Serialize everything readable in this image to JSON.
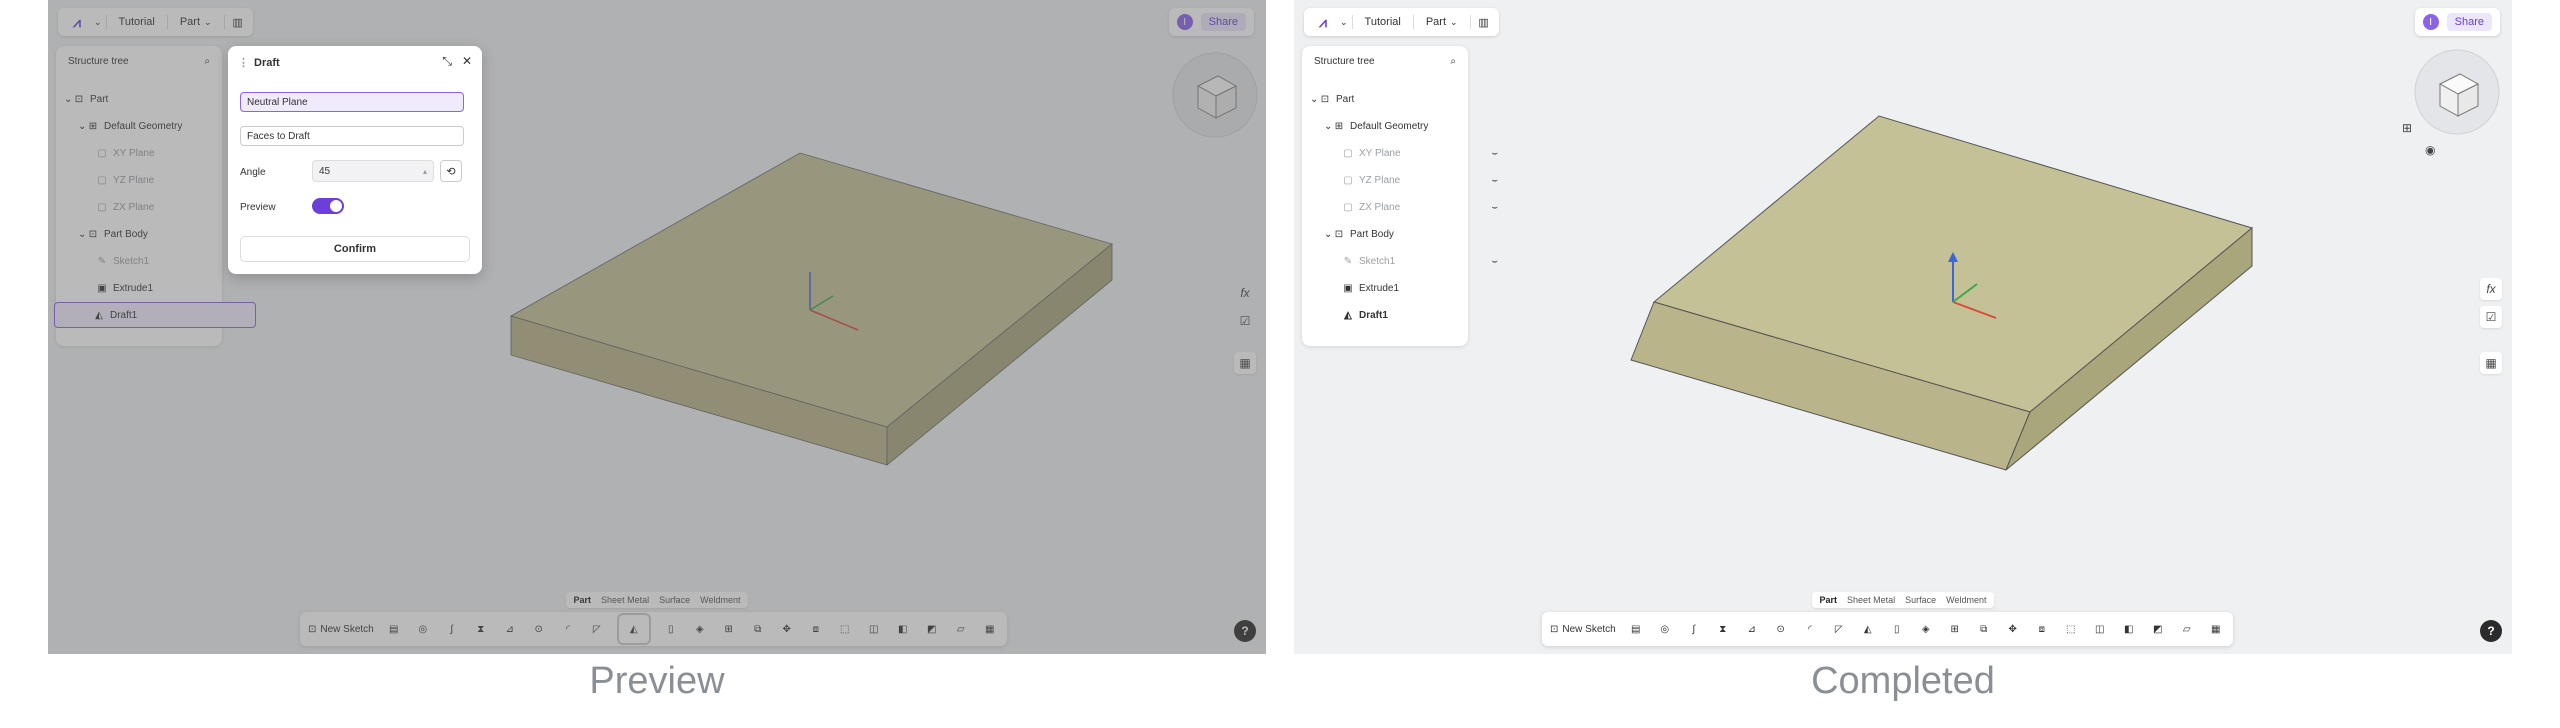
{
  "panels": [
    {
      "caption": "Preview",
      "topbar": {
        "project": "Tutorial",
        "mode": "Part"
      },
      "share_label": "Share",
      "avatar_letter": "I",
      "tree": {
        "title": "Structure tree",
        "items": [
          {
            "label": "Part"
          },
          {
            "label": "Default Geometry"
          },
          {
            "label": "XY Plane"
          },
          {
            "label": "YZ Plane"
          },
          {
            "label": "ZX Plane"
          },
          {
            "label": "Part Body"
          },
          {
            "label": "Sketch1"
          },
          {
            "label": "Extrude1"
          },
          {
            "label": "Draft1"
          }
        ]
      },
      "dialog": {
        "title": "Draft",
        "neutral_plane": "Neutral Plane",
        "faces_to_draft": "Faces to Draft",
        "angle_label": "Angle",
        "angle_value": "45",
        "preview_label": "Preview",
        "preview_on": true,
        "confirm_label": "Confirm"
      },
      "bottom_tabs": [
        "Part",
        "Sheet Metal",
        "Surface",
        "Weldment"
      ],
      "new_sketch_label": "New Sketch",
      "help_label": "?"
    },
    {
      "caption": "Completed",
      "topbar": {
        "project": "Tutorial",
        "mode": "Part"
      },
      "share_label": "Share",
      "avatar_letter": "I",
      "tree": {
        "title": "Structure tree",
        "items": [
          {
            "label": "Part"
          },
          {
            "label": "Default Geometry"
          },
          {
            "label": "XY Plane"
          },
          {
            "label": "YZ Plane"
          },
          {
            "label": "ZX Plane"
          },
          {
            "label": "Part Body"
          },
          {
            "label": "Sketch1"
          },
          {
            "label": "Extrude1"
          },
          {
            "label": "Draft1"
          }
        ]
      },
      "bottom_tabs": [
        "Part",
        "Sheet Metal",
        "Surface",
        "Weldment"
      ],
      "new_sketch_label": "New Sketch",
      "help_label": "?"
    }
  ],
  "colors": {
    "accent": "#6b3fd8",
    "model_top": "#c5c197",
    "model_front": "#b9b489",
    "model_side": "#aaa67c"
  }
}
